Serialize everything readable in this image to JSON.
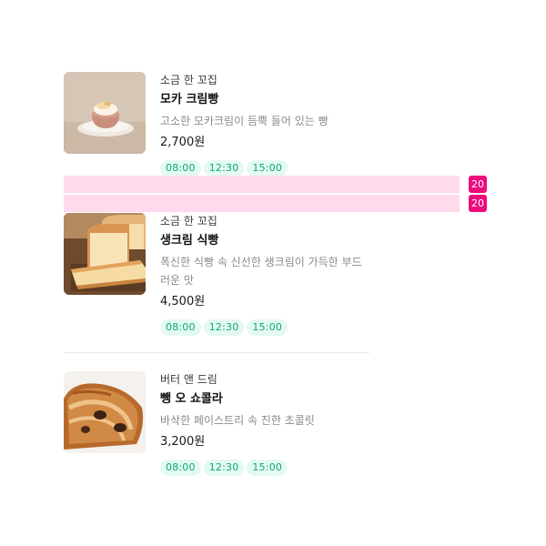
{
  "products": [
    {
      "store": "소금 한 꼬집",
      "name": "모카 크림빵",
      "description": "고소한 모카크림이 듬뿍 들어 있는 빵",
      "price": "2,700원",
      "times": [
        "08:00",
        "12:30",
        "15:00"
      ],
      "image_icon": "mocha-cream-bun-image"
    },
    {
      "store": "소금 한 꼬집",
      "name": "생크림 식빵",
      "description": "폭신한 식빵 속 신선한 생크림이 가득한 부드러운 맛",
      "price": "4,500원",
      "times": [
        "08:00",
        "12:30",
        "15:00"
      ],
      "image_icon": "cream-bread-loaf-image"
    },
    {
      "store": "버터 앤 드림",
      "name": "뺑 오 쇼콜라",
      "description": "바삭한 페이스트리 속 진한 초콜릿",
      "price": "3,200원",
      "times": [
        "08:00",
        "12:30",
        "15:00"
      ],
      "image_icon": "pain-au-chocolat-image"
    }
  ],
  "overlay": {
    "badges": [
      "20",
      "20"
    ],
    "bar_color": "#ffd9ec",
    "badge_color": "#ec0c7c"
  },
  "colors": {
    "chip_bg": "#e3f9f1",
    "chip_text": "#0fa974",
    "divider": "#e9e9e9"
  }
}
